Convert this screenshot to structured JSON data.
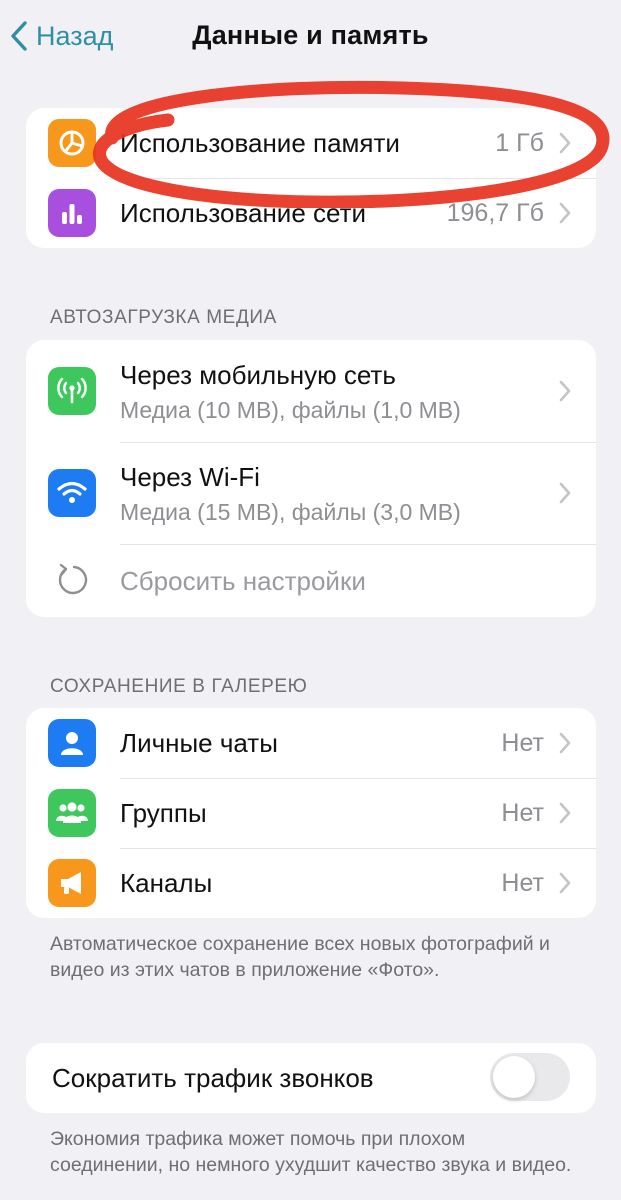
{
  "nav": {
    "back_label": "Назад",
    "title": "Данные и память"
  },
  "usage": {
    "items": [
      {
        "label": "Использование памяти",
        "value": "1 Гб",
        "icon": "pie-chart-icon",
        "color": "#f7971c"
      },
      {
        "label": "Использование сети",
        "value": "196,7 Гб",
        "icon": "bar-chart-icon",
        "color": "#a84fe0"
      }
    ]
  },
  "autoload": {
    "header": "АВТОЗАГРУЗКА МЕДИА",
    "items": [
      {
        "label": "Через мобильную сеть",
        "subtitle": "Медиа (10 MB), файлы (1,0 MB)",
        "icon": "cellular-antenna-icon",
        "color": "#3ec75c"
      },
      {
        "label": "Через Wi-Fi",
        "subtitle": "Медиа (15 MB), файлы (3,0 MB)",
        "icon": "wifi-icon",
        "color": "#1d7cf2"
      }
    ],
    "reset_label": "Сбросить настройки"
  },
  "gallery": {
    "header": "СОХРАНЕНИЕ В ГАЛЕРЕЮ",
    "items": [
      {
        "label": "Личные чаты",
        "value": "Нет",
        "icon": "person-icon",
        "color": "#1d7cf2"
      },
      {
        "label": "Группы",
        "value": "Нет",
        "icon": "group-icon",
        "color": "#3ec75c"
      },
      {
        "label": "Каналы",
        "value": "Нет",
        "icon": "megaphone-icon",
        "color": "#f7971c"
      }
    ],
    "footnote": "Автоматическое сохранение всех новых фотографий и видео из этих чатов в приложение «Фото»."
  },
  "calls": {
    "label": "Сократить трафик звонков",
    "enabled": false,
    "footnote": "Экономия трафика может помочь при плохом соединении, но немного ухудшит качество звука и видео."
  },
  "colors": {
    "accent": "#2f8fa4",
    "annotation": "#e8321f"
  }
}
